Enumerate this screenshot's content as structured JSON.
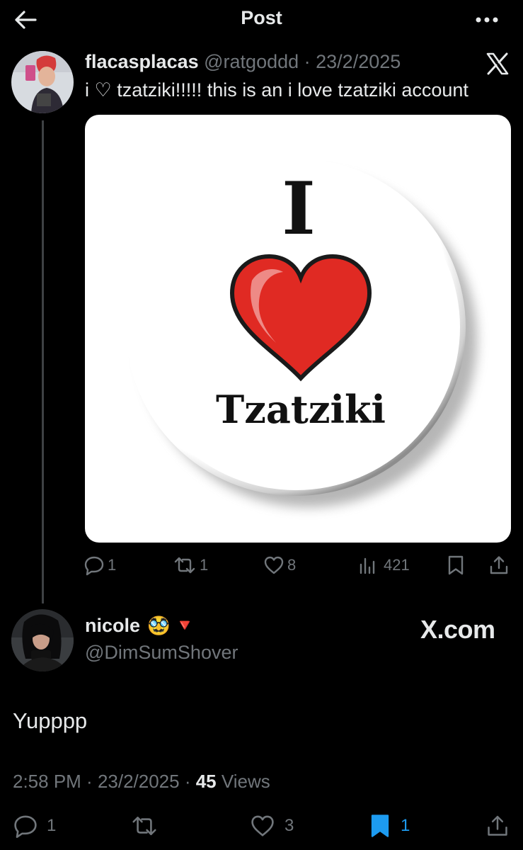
{
  "header": {
    "title": "Post",
    "back_icon": "back-arrow-icon",
    "more_icon": "more-dots-icon"
  },
  "quoted_post": {
    "display_name": "flacasplacas",
    "handle": "@ratgoddd",
    "separator": " · ",
    "date": "23/2/2025",
    "text": "i ♡ tzatziki!!!!! this is an i love tzatziki account",
    "media": {
      "line1": "I",
      "line3": "Tzatziki",
      "heart_color": "#e02a23"
    },
    "stats": {
      "replies": "1",
      "reposts": "1",
      "likes": "8",
      "views": "421"
    }
  },
  "reply": {
    "display_name": "nicole",
    "emojis": [
      "🥸",
      "🔻"
    ],
    "handle": "@DimSumShover",
    "brand": "X.com",
    "text": "Yupppp",
    "time": "2:58 PM",
    "separator": " · ",
    "date": "23/2/2025",
    "views_count": "45",
    "views_label": " Views",
    "stats": {
      "replies": "1",
      "likes": "3",
      "bookmarks": "1"
    }
  },
  "colors": {
    "background": "#000000",
    "text": "#e7e9ea",
    "muted": "#71767b",
    "accent": "#1d9bf0",
    "thread_line": "#3e4144"
  }
}
